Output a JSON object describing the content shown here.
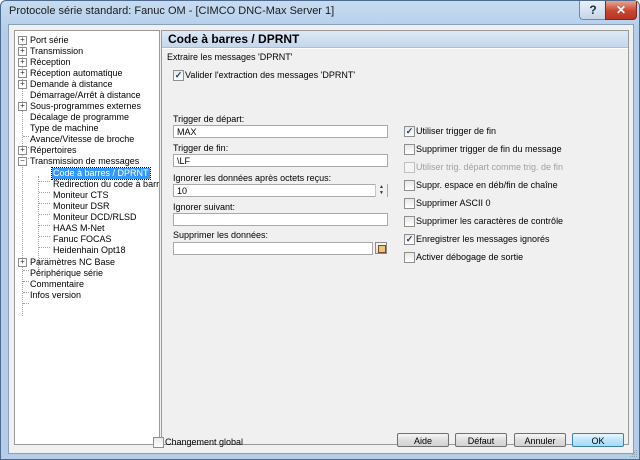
{
  "window": {
    "title": "Protocole série standard: Fanuc OM - [CIMCO DNC-Max Server 1]",
    "help_label": "?",
    "close_label": "✕"
  },
  "tree": {
    "items": [
      {
        "label": "Port série",
        "expander": "+"
      },
      {
        "label": "Transmission",
        "expander": "+"
      },
      {
        "label": "Réception",
        "expander": "+"
      },
      {
        "label": "Réception automatique",
        "expander": "+"
      },
      {
        "label": "Demande à distance",
        "expander": "+"
      },
      {
        "label": "Démarrage/Arrêt à distance",
        "expander": ""
      },
      {
        "label": "Sous-programmes externes",
        "expander": "+"
      },
      {
        "label": "Décalage de programme",
        "expander": ""
      },
      {
        "label": "Type de machine",
        "expander": ""
      },
      {
        "label": "Avance/Vitesse de broche",
        "expander": ""
      },
      {
        "label": "Répertoires",
        "expander": "+"
      },
      {
        "label": "Transmission de messages",
        "expander": "−"
      },
      {
        "label": "Code à barres / DPRNT",
        "expander": ""
      },
      {
        "label": "Redirection du code à barres",
        "expander": ""
      },
      {
        "label": "Moniteur CTS",
        "expander": ""
      },
      {
        "label": "Moniteur DSR",
        "expander": ""
      },
      {
        "label": "Moniteur DCD/RLSD",
        "expander": ""
      },
      {
        "label": "HAAS M-Net",
        "expander": ""
      },
      {
        "label": "Fanuc FOCAS",
        "expander": ""
      },
      {
        "label": "Heidenhain Opt18",
        "expander": ""
      },
      {
        "label": "Paramètres NC Base",
        "expander": "+"
      },
      {
        "label": "Périphérique série",
        "expander": ""
      },
      {
        "label": "Commentaire",
        "expander": ""
      },
      {
        "label": "Infos version",
        "expander": ""
      }
    ]
  },
  "panel": {
    "title": "Code à barres / DPRNT",
    "group_caption": "Extraire les messages 'DPRNT'",
    "enable": {
      "label": "Valider l'extraction des messages 'DPRNT'",
      "checked": "✓"
    },
    "fields": {
      "start_trigger": {
        "label": "Trigger de départ:",
        "value": "MAX"
      },
      "end_trigger": {
        "label": "Trigger de fin:",
        "value": "\\LF"
      },
      "ignore_after": {
        "label": "Ignorer les données après octets reçus:",
        "value": "10",
        "spin_up": "▲",
        "spin_down": "▼"
      },
      "ignore_next": {
        "label": "Ignorer suivant:",
        "value": ""
      },
      "delete_data": {
        "label": "Supprimer les données:",
        "value": ""
      }
    },
    "options": [
      {
        "label": "Utiliser trigger de fin",
        "checked": "✓",
        "disabled": false
      },
      {
        "label": "Supprimer trigger de fin du message",
        "checked": "",
        "disabled": false
      },
      {
        "label": "Utiliser trig. départ comme trig. de fin",
        "checked": "",
        "disabled": true
      },
      {
        "label": "Suppr. espace en déb/fin de chaîne",
        "checked": "",
        "disabled": false
      },
      {
        "label": "Supprimer ASCII 0",
        "checked": "",
        "disabled": false
      },
      {
        "label": "Supprimer les caractères de contrôle",
        "checked": "",
        "disabled": false
      },
      {
        "label": "Enregistrer les messages ignorés",
        "checked": "✓",
        "disabled": false
      },
      {
        "label": "Activer débogage de sortie",
        "checked": "",
        "disabled": false
      }
    ]
  },
  "footer": {
    "global_change": {
      "label": "Changement global",
      "checked": ""
    },
    "buttons": {
      "help": "Aide",
      "default": "Défaut",
      "cancel": "Annuler",
      "ok": "OK"
    }
  }
}
